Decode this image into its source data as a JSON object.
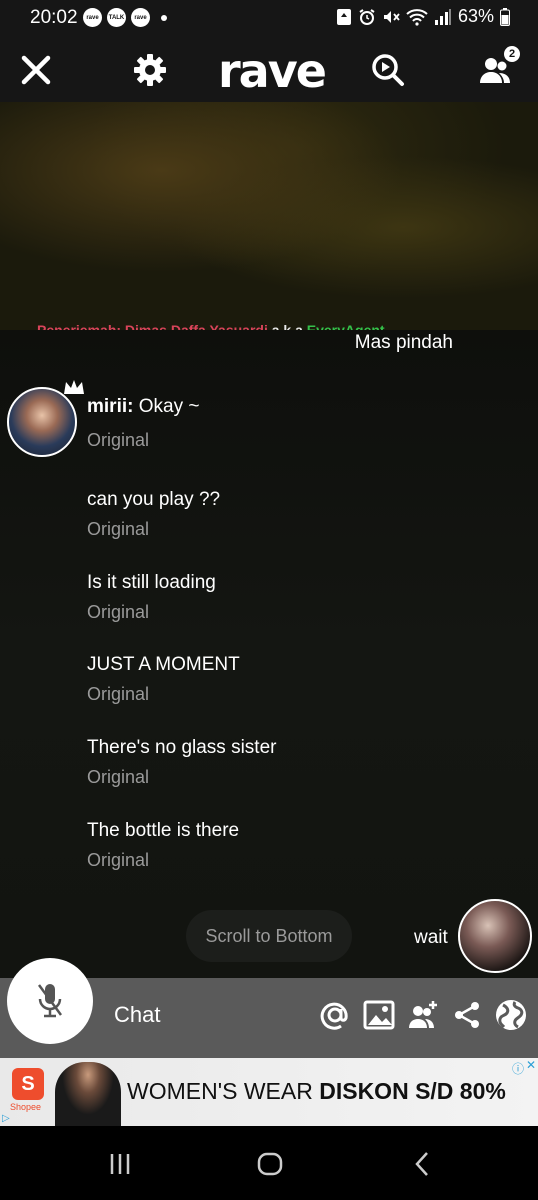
{
  "status": {
    "time": "20:02",
    "apps": [
      "rave",
      "TALK",
      "rave"
    ],
    "battery": "63%"
  },
  "toolbar": {
    "logo": "rave",
    "participants_badge": "2"
  },
  "video": {
    "subtitle_red": "Penerjemah: Dimas Daffa Yasuardi",
    "subtitle_white": " a.k.a ",
    "subtitle_green": "EveryAgent"
  },
  "chat": {
    "top_message": "Mas pindah",
    "sender": "mirii:",
    "messages": [
      {
        "text": "Okay ~",
        "original": "Original"
      },
      {
        "text": "can you play ??",
        "original": "Original"
      },
      {
        "text": "Is it still loading",
        "original": "Original"
      },
      {
        "text": "JUST A MOMENT",
        "original": "Original"
      },
      {
        "text": "There's no glass sister",
        "original": "Original"
      },
      {
        "text": "The bottle is there",
        "original": "Original"
      }
    ],
    "scroll_to_bottom": "Scroll to Bottom",
    "wait_message": "wait"
  },
  "input": {
    "placeholder": "Chat"
  },
  "ad": {
    "brand": "Shopee",
    "text_regular": "WOMEN'S WEAR ",
    "text_bold": "DISKON S/D 80%"
  }
}
